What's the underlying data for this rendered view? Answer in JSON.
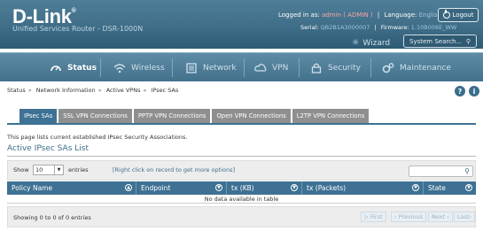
{
  "header": {
    "brand": "D-Link",
    "trademark": "®",
    "subtitle": "Unified Services Router - DSR-1000N",
    "logged_in_label": "Logged in as:",
    "logged_in_user": "admin ( ADMIN )",
    "language_label": "Language:",
    "language_value": "English [US]",
    "logout_label": "Logout",
    "serial_label": "Serial:",
    "serial_value": "QB2B1A3000007",
    "firmware_label": "Firmware:",
    "firmware_value": "1.10B006E_WW",
    "wizard_label": "Wizard",
    "search_placeholder": "System Search..."
  },
  "nav": {
    "items": [
      {
        "label": "Status",
        "icon": "gauge-icon",
        "active": true
      },
      {
        "label": "Wireless",
        "icon": "wifi-icon",
        "active": false
      },
      {
        "label": "Network",
        "icon": "network-icon",
        "active": false
      },
      {
        "label": "VPN",
        "icon": "vpn-icon",
        "active": false
      },
      {
        "label": "Security",
        "icon": "lock-icon",
        "active": false
      },
      {
        "label": "Maintenance",
        "icon": "gears-icon",
        "active": false
      }
    ]
  },
  "breadcrumb": {
    "items": [
      "Status",
      "Network Information",
      "Active VPNs",
      "IPsec SAs"
    ]
  },
  "tabs": [
    "IPsec SAs",
    "SSL VPN Connections",
    "PPTP VPN Connections",
    "Open VPN Connections",
    "L2TP VPN Connections"
  ],
  "page": {
    "description": "This page lists current established IPsec Security Associations.",
    "list_title": "Active IPsec SAs List"
  },
  "table": {
    "show_label": "Show",
    "entries_value": "10",
    "entries_label": "entries",
    "hint": "[Right click on record to get more options]",
    "columns": [
      "Policy Name",
      "Endpoint",
      "tx (KB)",
      "tx (Packets)",
      "State"
    ],
    "empty_message": "No data available in table",
    "showing": "Showing 0 to 0 of 0 entries",
    "pager": [
      "First",
      "Previous",
      "Next",
      "Last"
    ]
  },
  "colors": {
    "header": "#3e6c86",
    "table_header": "#3e7193",
    "tab_active": "#3d7295",
    "tab_inactive": "#8f8f8f"
  }
}
